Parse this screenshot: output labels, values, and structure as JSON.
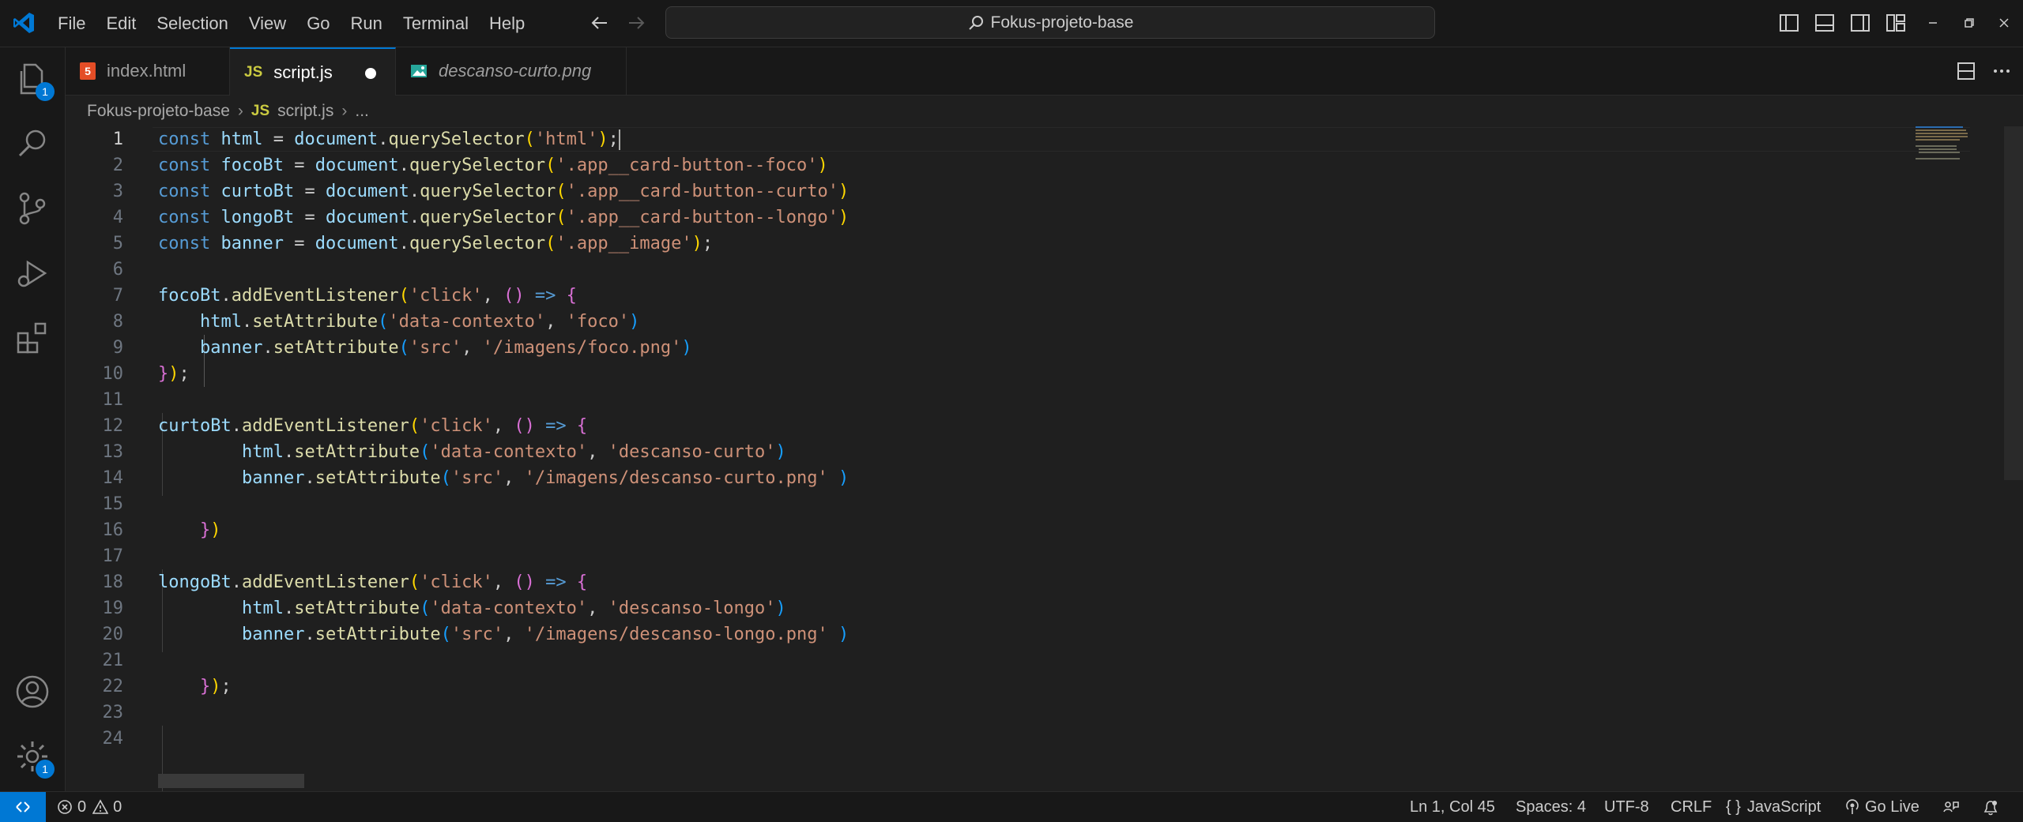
{
  "menu": [
    "File",
    "Edit",
    "Selection",
    "View",
    "Go",
    "Run",
    "Terminal",
    "Help"
  ],
  "search": {
    "text": "Fokus-projeto-base"
  },
  "activity": {
    "explorer_badge": "1",
    "manage_badge": "1"
  },
  "tabs": [
    {
      "label": "index.html",
      "icon": "html-file-icon",
      "active": false
    },
    {
      "label": "script.js",
      "icon": "js-file-icon",
      "active": true,
      "dirty": true
    },
    {
      "label": "descanso-curto.png",
      "icon": "image-file-icon",
      "active": false
    }
  ],
  "breadcrumb": {
    "folder": "Fokus-projeto-base",
    "file_icon": "JS",
    "file": "script.js",
    "more": "..."
  },
  "tab_icons": {
    "js": "JS",
    "html": "5"
  },
  "status": {
    "errors": "0",
    "warnings": "0",
    "position": "Ln 1, Col 45",
    "spaces": "Spaces: 4",
    "encoding": "UTF-8",
    "eol": "CRLF",
    "language": "JavaScript",
    "golive": "Go Live"
  },
  "code": [
    [
      [
        "k",
        "const "
      ],
      [
        "v",
        "html"
      ],
      [
        "p",
        " = "
      ],
      [
        "v",
        "document"
      ],
      [
        "p",
        "."
      ],
      [
        "f",
        "querySelector"
      ],
      [
        "b1",
        "("
      ],
      [
        "s",
        "'html'"
      ],
      [
        "b1",
        ")"
      ],
      [
        "p",
        ";"
      ]
    ],
    [
      [
        "k",
        "const "
      ],
      [
        "v",
        "focoBt"
      ],
      [
        "p",
        " = "
      ],
      [
        "v",
        "document"
      ],
      [
        "p",
        "."
      ],
      [
        "f",
        "querySelector"
      ],
      [
        "b1",
        "("
      ],
      [
        "s",
        "'.app__card-button--foco'"
      ],
      [
        "b1",
        ")"
      ]
    ],
    [
      [
        "k",
        "const "
      ],
      [
        "v",
        "curtoBt"
      ],
      [
        "p",
        " = "
      ],
      [
        "v",
        "document"
      ],
      [
        "p",
        "."
      ],
      [
        "f",
        "querySelector"
      ],
      [
        "b1",
        "("
      ],
      [
        "s",
        "'.app__card-button--curto'"
      ],
      [
        "b1",
        ")"
      ]
    ],
    [
      [
        "k",
        "const "
      ],
      [
        "v",
        "longoBt"
      ],
      [
        "p",
        " = "
      ],
      [
        "v",
        "document"
      ],
      [
        "p",
        "."
      ],
      [
        "f",
        "querySelector"
      ],
      [
        "b1",
        "("
      ],
      [
        "s",
        "'.app__card-button--longo'"
      ],
      [
        "b1",
        ")"
      ]
    ],
    [
      [
        "k",
        "const "
      ],
      [
        "v",
        "banner"
      ],
      [
        "p",
        " = "
      ],
      [
        "v",
        "document"
      ],
      [
        "p",
        "."
      ],
      [
        "f",
        "querySelector"
      ],
      [
        "b1",
        "("
      ],
      [
        "s",
        "'.app__image'"
      ],
      [
        "b1",
        ")"
      ],
      [
        "p",
        ";"
      ]
    ],
    [],
    [
      [
        "v",
        "focoBt"
      ],
      [
        "p",
        "."
      ],
      [
        "f",
        "addEventListener"
      ],
      [
        "b1",
        "("
      ],
      [
        "s",
        "'click'"
      ],
      [
        "p",
        ", "
      ],
      [
        "b2",
        "()"
      ],
      [
        "k",
        " =>"
      ],
      [
        "p",
        " "
      ],
      [
        "b2",
        "{"
      ]
    ],
    [
      [
        "p",
        "    "
      ],
      [
        "v",
        "html"
      ],
      [
        "p",
        "."
      ],
      [
        "f",
        "setAttribute"
      ],
      [
        "b3",
        "("
      ],
      [
        "s",
        "'data-contexto'"
      ],
      [
        "p",
        ", "
      ],
      [
        "s",
        "'foco'"
      ],
      [
        "b3",
        ")"
      ]
    ],
    [
      [
        "p",
        "    "
      ],
      [
        "v",
        "banner"
      ],
      [
        "p",
        "."
      ],
      [
        "f",
        "setAttribute"
      ],
      [
        "b3",
        "("
      ],
      [
        "s",
        "'src'"
      ],
      [
        "p",
        ", "
      ],
      [
        "s",
        "'/imagens/foco.png'"
      ],
      [
        "b3",
        ")"
      ]
    ],
    [
      [
        "b2",
        "}"
      ],
      [
        "b1",
        ")"
      ],
      [
        "p",
        ";"
      ]
    ],
    [],
    [
      [
        "v",
        "curtoBt"
      ],
      [
        "p",
        "."
      ],
      [
        "f",
        "addEventListener"
      ],
      [
        "b1",
        "("
      ],
      [
        "s",
        "'click'"
      ],
      [
        "p",
        ", "
      ],
      [
        "b2",
        "()"
      ],
      [
        "k",
        " =>"
      ],
      [
        "p",
        " "
      ],
      [
        "b2",
        "{"
      ]
    ],
    [
      [
        "p",
        "        "
      ],
      [
        "v",
        "html"
      ],
      [
        "p",
        "."
      ],
      [
        "f",
        "setAttribute"
      ],
      [
        "b3",
        "("
      ],
      [
        "s",
        "'data-contexto'"
      ],
      [
        "p",
        ", "
      ],
      [
        "s",
        "'descanso-curto'"
      ],
      [
        "b3",
        ")"
      ]
    ],
    [
      [
        "p",
        "        "
      ],
      [
        "v",
        "banner"
      ],
      [
        "p",
        "."
      ],
      [
        "f",
        "setAttribute"
      ],
      [
        "b3",
        "("
      ],
      [
        "s",
        "'src'"
      ],
      [
        "p",
        ", "
      ],
      [
        "s",
        "'/imagens/descanso-curto.png'"
      ],
      [
        "p",
        " "
      ],
      [
        "b3",
        ")"
      ]
    ],
    [],
    [
      [
        "p",
        "    "
      ],
      [
        "b2",
        "}"
      ],
      [
        "b1",
        ")"
      ]
    ],
    [],
    [
      [
        "v",
        "longoBt"
      ],
      [
        "p",
        "."
      ],
      [
        "f",
        "addEventListener"
      ],
      [
        "b1",
        "("
      ],
      [
        "s",
        "'click'"
      ],
      [
        "p",
        ", "
      ],
      [
        "b2",
        "()"
      ],
      [
        "k",
        " =>"
      ],
      [
        "p",
        " "
      ],
      [
        "b2",
        "{"
      ]
    ],
    [
      [
        "p",
        "        "
      ],
      [
        "v",
        "html"
      ],
      [
        "p",
        "."
      ],
      [
        "f",
        "setAttribute"
      ],
      [
        "b3",
        "("
      ],
      [
        "s",
        "'data-contexto'"
      ],
      [
        "p",
        ", "
      ],
      [
        "s",
        "'descanso-longo'"
      ],
      [
        "b3",
        ")"
      ]
    ],
    [
      [
        "p",
        "        "
      ],
      [
        "v",
        "banner"
      ],
      [
        "p",
        "."
      ],
      [
        "f",
        "setAttribute"
      ],
      [
        "b3",
        "("
      ],
      [
        "s",
        "'src'"
      ],
      [
        "p",
        ", "
      ],
      [
        "s",
        "'/imagens/descanso-longo.png'"
      ],
      [
        "p",
        " "
      ],
      [
        "b3",
        ")"
      ]
    ],
    [],
    [
      [
        "p",
        "    "
      ],
      [
        "b2",
        "}"
      ],
      [
        "b1",
        ")"
      ],
      [
        "p",
        ";"
      ]
    ],
    [],
    []
  ]
}
